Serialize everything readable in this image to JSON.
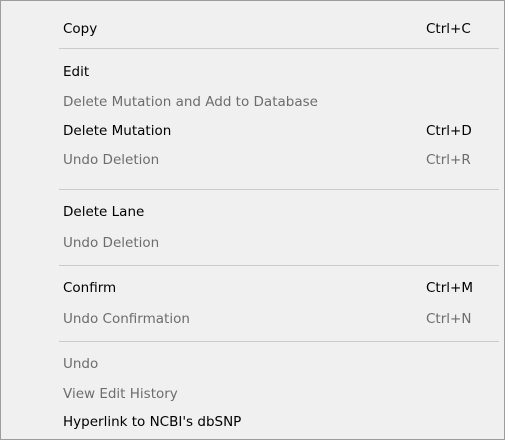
{
  "menu": {
    "items": [
      {
        "label": "Copy",
        "shortcut": "Ctrl+C",
        "enabled": true
      },
      {
        "label": "Edit",
        "shortcut": "",
        "enabled": true
      },
      {
        "label": "Delete Mutation and Add to Database",
        "shortcut": "",
        "enabled": false
      },
      {
        "label": "Delete Mutation",
        "shortcut": "Ctrl+D",
        "enabled": true
      },
      {
        "label": "Undo Deletion",
        "shortcut": "Ctrl+R",
        "enabled": false
      },
      {
        "label": "Delete Lane",
        "shortcut": "",
        "enabled": true
      },
      {
        "label": "Undo Deletion",
        "shortcut": "",
        "enabled": false
      },
      {
        "label": "Confirm",
        "shortcut": "Ctrl+M",
        "enabled": true
      },
      {
        "label": "Undo Confirmation",
        "shortcut": "Ctrl+N",
        "enabled": false
      },
      {
        "label": "Undo",
        "shortcut": "",
        "enabled": false
      },
      {
        "label": "View Edit History",
        "shortcut": "",
        "enabled": false
      },
      {
        "label": "Hyperlink to NCBI's dbSNP",
        "shortcut": "",
        "enabled": true
      }
    ]
  },
  "colors": {
    "background": "#f0f0f0",
    "enabled_text": "#000000",
    "disabled_text": "#6d6d6d",
    "separator": "#cbcbcb",
    "border": "#9d9d9d"
  }
}
